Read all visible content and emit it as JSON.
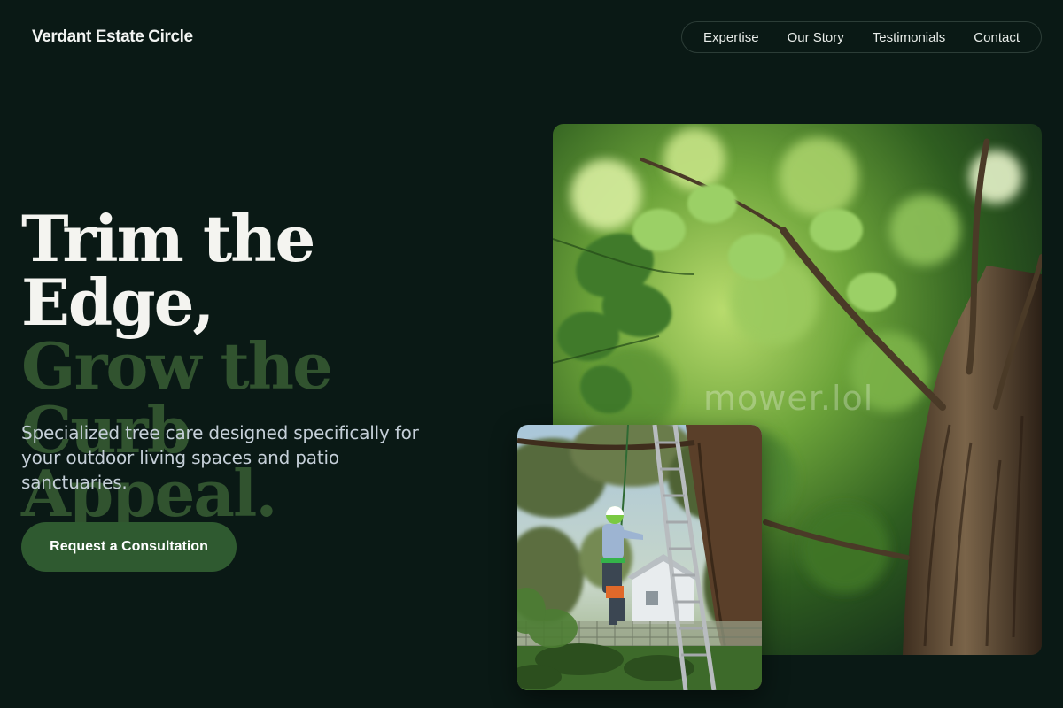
{
  "header": {
    "brand": "Verdant Estate Circle",
    "nav": [
      "Expertise",
      "Our Story",
      "Testimonials",
      "Contact"
    ]
  },
  "hero": {
    "headline_line1": "Trim the Edge,",
    "headline_line2": "Grow the Curb",
    "headline_line3": "Appeal.",
    "subtext": "Specialized tree care designed specifically for your outdoor living spaces and patio sanctuaries.",
    "cta_label": "Request a Consultation"
  },
  "images": {
    "large_alt": "Sunlit tree canopy with green leaves and trunk",
    "small_alt": "Arborist in helmet climbing a tree beside a ladder",
    "watermark": "mower.lol"
  },
  "colors": {
    "background": "#0a1915",
    "accent_green": "#2f5a30",
    "headline_muted": "#31532f",
    "text_light": "#f4f4f0"
  }
}
